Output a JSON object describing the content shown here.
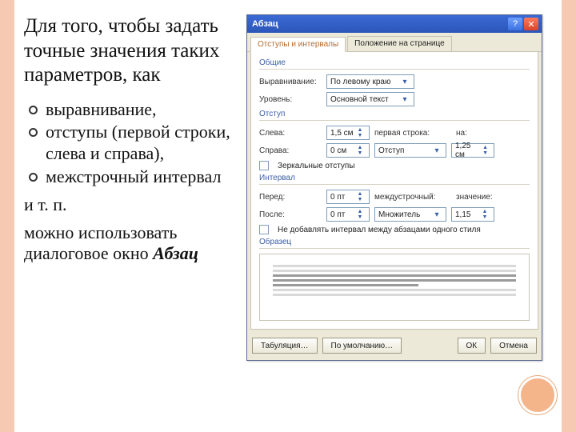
{
  "left": {
    "heading": "Для того, чтобы задать точные значения таких параметров, как",
    "bullets": [
      "выравнивание,",
      "отступы (первой строки, слева и справа),",
      "межстрочный интервал"
    ],
    "tail": "и т. п.",
    "para2_prefix": "можно использовать диалоговое окно ",
    "para2_em": "Абзац"
  },
  "dialog": {
    "title": "Абзац",
    "tabs": {
      "t1": "Отступы и интервалы",
      "t2": "Положение на странице"
    },
    "groups": {
      "general": "Общие",
      "indent": "Отступ",
      "spacing": "Интервал",
      "preview": "Образец"
    },
    "general": {
      "align_label": "Выравнивание:",
      "align_value": "По левому краю",
      "level_label": "Уровень:",
      "level_value": "Основной текст"
    },
    "indent": {
      "left_label": "Слева:",
      "left_value": "1,5 см",
      "right_label": "Справа:",
      "right_value": "0 см",
      "firstline_label": "первая строка:",
      "firstline_value": "Отступ",
      "by_label": "на:",
      "by_value": "1,25 см",
      "hanging_blank": "на:",
      "mirror_label": "Зеркальные отступы"
    },
    "spacing": {
      "before_label": "Перед:",
      "before_value": "0 пт",
      "after_label": "После:",
      "after_value": "0 пт",
      "line_label": "междустрочный:",
      "line_value": "Множитель",
      "at_label": "значение:",
      "at_value": "1,15",
      "nospace_label": "Не добавлять интервал между абзацами одного стиля"
    },
    "buttons": {
      "tabs": "Табуляция…",
      "default": "По умолчанию…",
      "ok": "ОК",
      "cancel": "Отмена"
    }
  }
}
